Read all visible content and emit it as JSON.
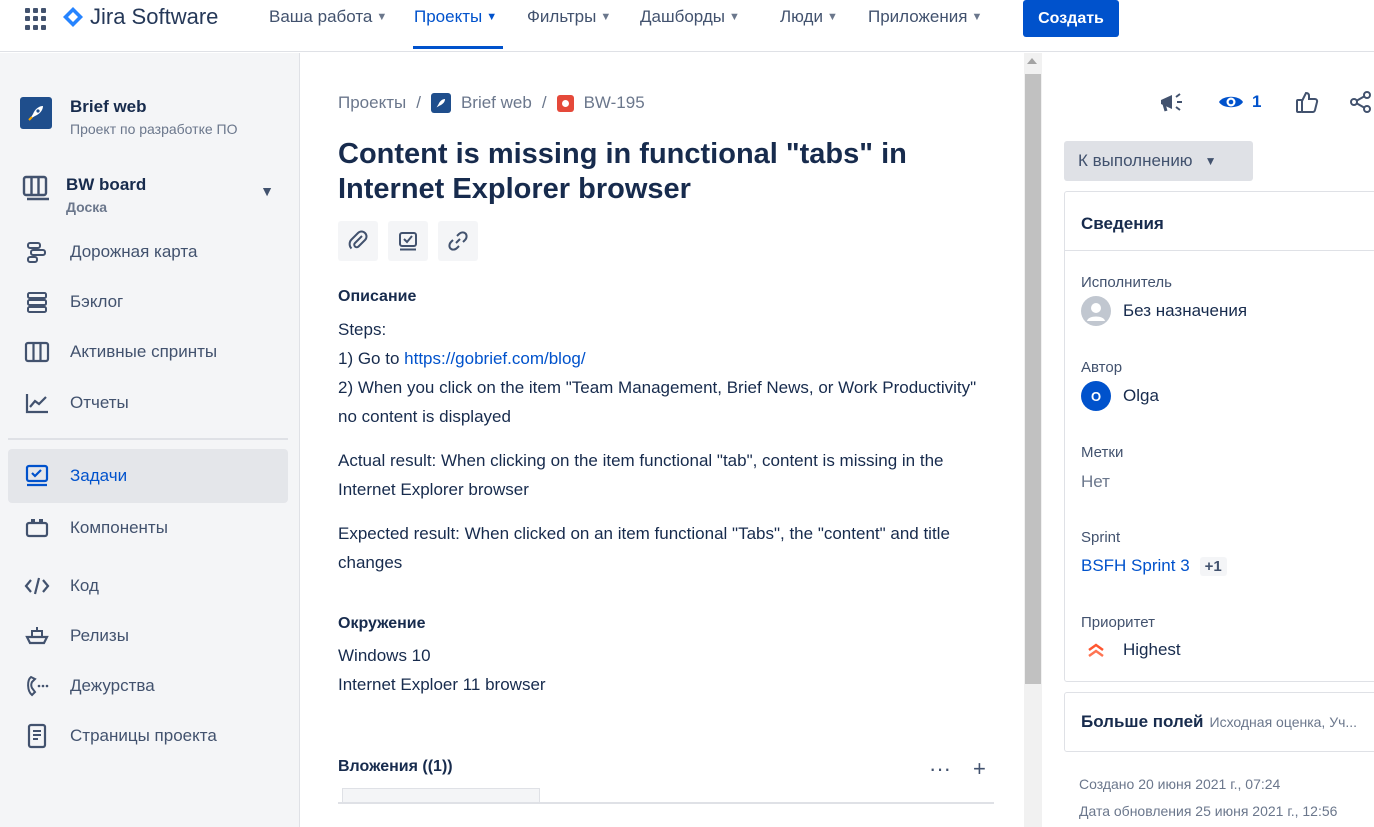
{
  "topnav": {
    "logo_text": "Jira Software",
    "items": [
      {
        "label": "Ваша работа"
      },
      {
        "label": "Проекты"
      },
      {
        "label": "Фильтры"
      },
      {
        "label": "Дашборды"
      },
      {
        "label": "Люди"
      },
      {
        "label": "Приложения"
      }
    ],
    "active_item": "Проекты",
    "create_label": "Создать",
    "brand_color": "#0052cc"
  },
  "sidebar": {
    "project_name": "Brief web",
    "project_type": "Проект по разработке ПО",
    "board_name": "BW board",
    "board_sub": "Доска",
    "items_top": [
      {
        "label": "Дорожная карта",
        "icon": "roadmap-icon"
      },
      {
        "label": "Бэклог",
        "icon": "backlog-icon"
      },
      {
        "label": "Активные спринты",
        "icon": "sprints-icon"
      },
      {
        "label": "Отчеты",
        "icon": "reports-icon"
      }
    ],
    "items_bottom": [
      {
        "label": "Задачи",
        "icon": "issues-icon",
        "active": true
      },
      {
        "label": "Компоненты",
        "icon": "components-icon"
      },
      {
        "label": "Код",
        "icon": "code-icon"
      },
      {
        "label": "Релизы",
        "icon": "releases-icon"
      },
      {
        "label": "Дежурства",
        "icon": "oncall-icon"
      },
      {
        "label": "Страницы проекта",
        "icon": "pages-icon"
      }
    ]
  },
  "issue": {
    "breadcrumb": {
      "projects": "Проекты",
      "project": "Brief web",
      "key": "BW-195"
    },
    "title": "Content is missing in functional \"tabs\" in Internet Explorer browser",
    "description_heading": "Описание",
    "description": {
      "steps_label": "Steps:",
      "step1_prefix": "1) Go to ",
      "step1_link": "https://gobrief.com/blog/",
      "step2": "2) When you click on the item \"Team Management, Brief News, or Work Productivity\" no content is displayed",
      "actual": "Actual result: When clicking on the item functional \"tab\", content is missing in the Internet Explorer browser",
      "expected": "Expected result: When clicked on an item functional \"Tabs\", the \"content\" and title changes"
    },
    "environment_heading": "Окружение",
    "environment_line1": "Windows 10",
    "environment_line2": "Internet Exploer 11 browser",
    "attachments_heading": "Вложения ((1))"
  },
  "right_panel": {
    "watchers_count": "1",
    "status_label": "К выполнению",
    "details_heading": "Сведения",
    "fields": {
      "assignee_label": "Исполнитель",
      "assignee_value": "Без назначения",
      "reporter_label": "Автор",
      "reporter_value": "Olga",
      "reporter_initial": "O",
      "labels_label": "Метки",
      "labels_value": "Нет",
      "sprint_label": "Sprint",
      "sprint_value": "BSFH Sprint 3",
      "sprint_more": "+1",
      "priority_label": "Приоритет",
      "priority_value": "Highest",
      "priority_color": "#ff5630"
    },
    "more_fields_heading": "Больше полей",
    "more_fields_sub": "Исходная оценка, Уч...",
    "created": "Создано 20 июня 2021 г., 07:24",
    "updated": "Дата обновления 25 июня 2021 г., 12:56"
  }
}
